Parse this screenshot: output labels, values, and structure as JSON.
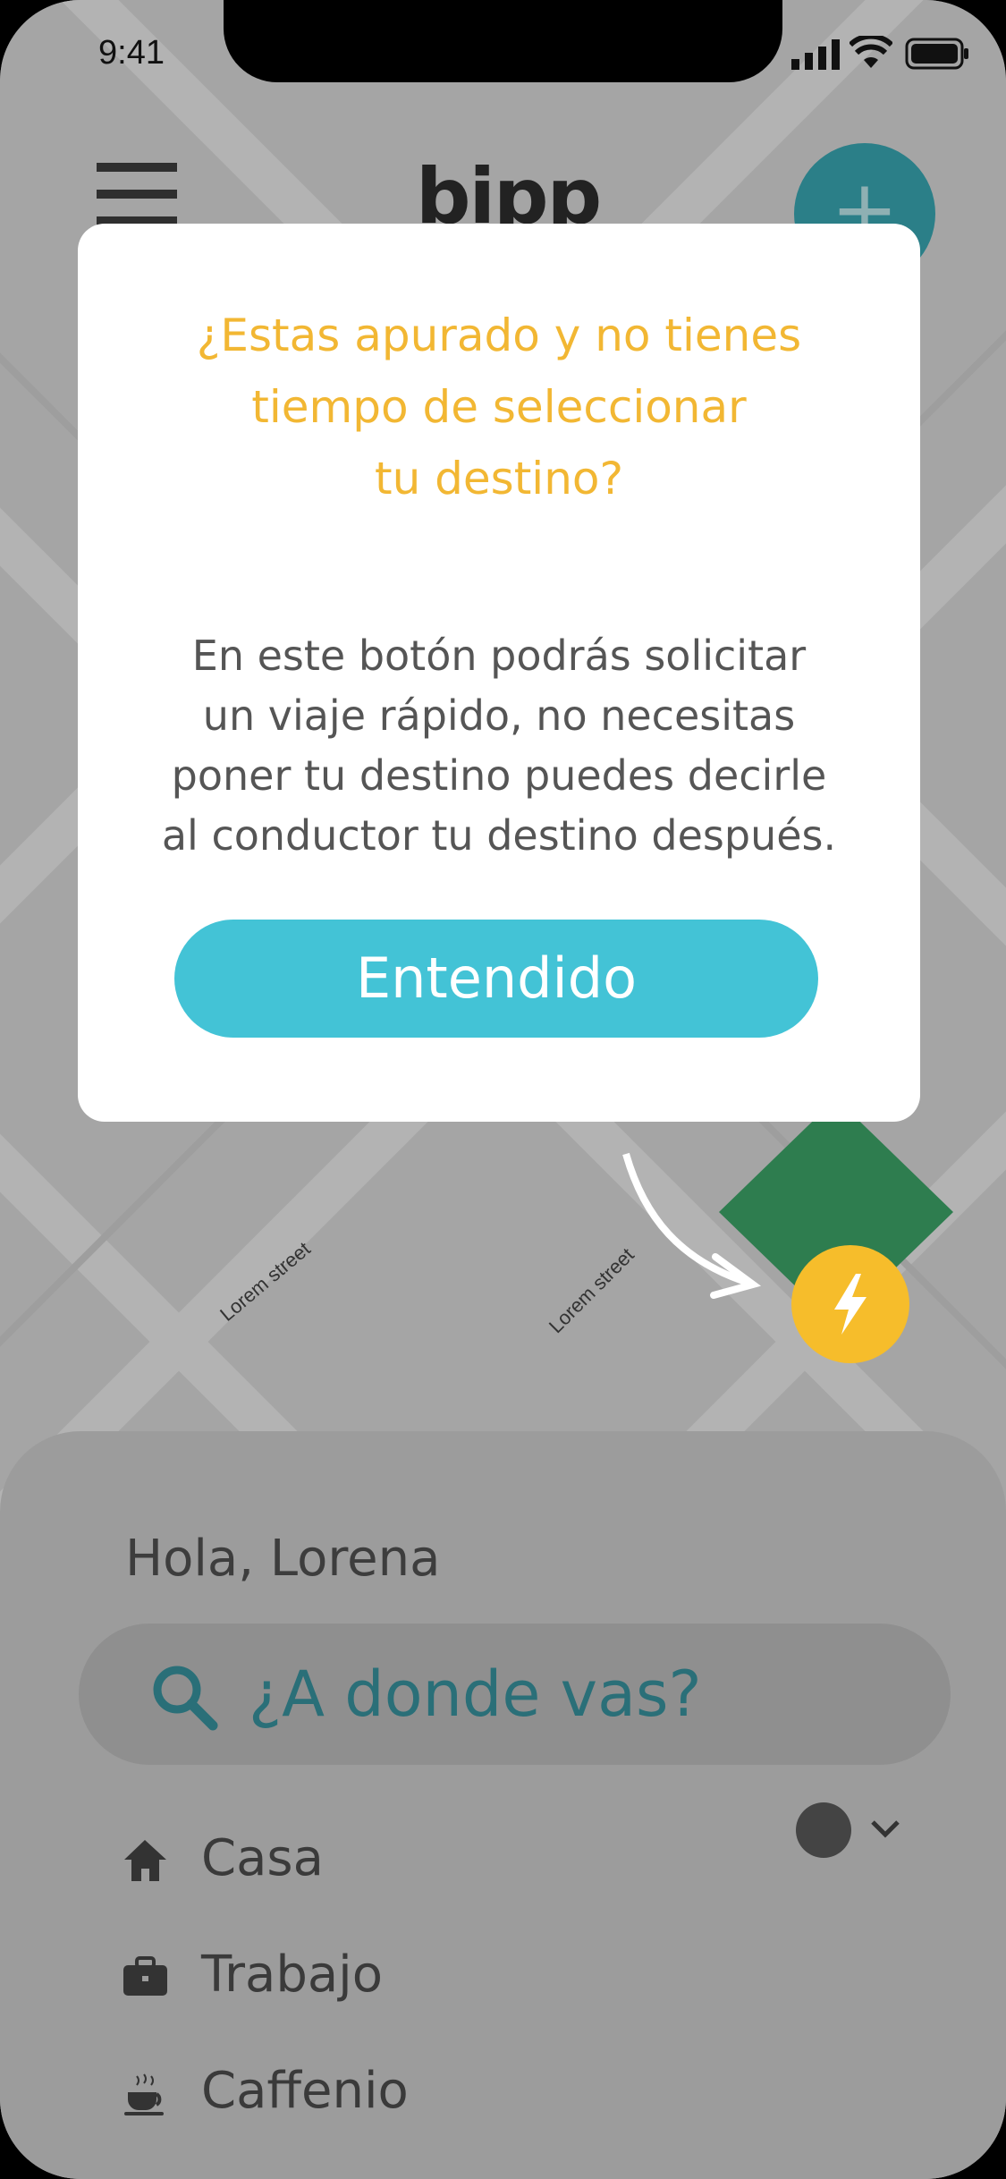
{
  "status_bar": {
    "time": "9:41"
  },
  "header": {
    "logo_text": "bipp"
  },
  "map": {
    "street_labels": [
      "Lorem street",
      "Lorem street"
    ]
  },
  "modal": {
    "title_lines": [
      "¿Estas apurado y no tienes",
      "tiempo de seleccionar",
      "tu destino?"
    ],
    "body_lines": [
      "En este botón podrás solicitar",
      "un viaje rápido, no necesitas",
      "poner tu destino puedes decirle",
      "al conductor tu destino después."
    ],
    "button_label": "Entendido"
  },
  "sheet": {
    "greeting": "Hola, Lorena",
    "search_placeholder": "¿A donde vas?",
    "locations": [
      {
        "label": "Casa",
        "icon": "home-icon"
      },
      {
        "label": "Trabajo",
        "icon": "briefcase-icon"
      },
      {
        "label": "Caffenio",
        "icon": "coffee-icon"
      }
    ]
  },
  "colors": {
    "accent_yellow": "#f2b733",
    "button_teal": "#43c3d6",
    "map_green": "#2e7d4f",
    "bolt_yellow": "#f6bd2b"
  }
}
